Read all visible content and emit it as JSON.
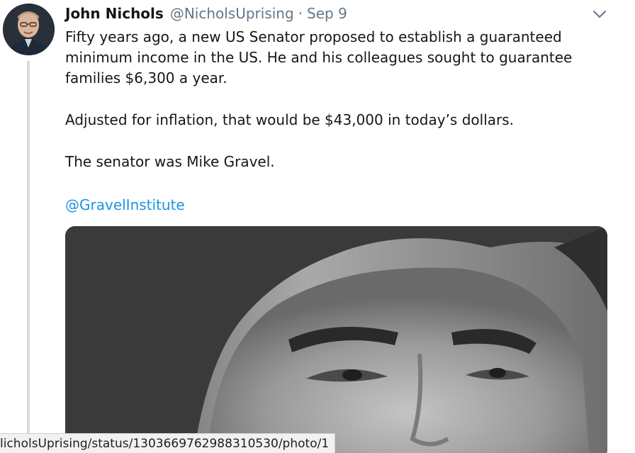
{
  "tweet": {
    "author_name": "John Nichols",
    "author_handle": "@NicholsUprising",
    "separator": "·",
    "date": "Sep 9",
    "lines": [
      "Fifty years ago, a new US Senator proposed to establish a guaranteed",
      "minimum income in the US. He and his colleagues sought to guarantee",
      "families $6,300 a year.",
      "Adjusted for inflation, that would be $43,000 in today’s dollars.",
      "The senator was Mike Gravel."
    ],
    "mention": "@GravelInstitute"
  },
  "icons": {
    "more": "chevron-down-icon"
  },
  "status_bar": {
    "url": "licholsUprising/status/1303669762988310530/photo/1"
  },
  "colors": {
    "link": "#1b95e0",
    "secondary_text": "#657786",
    "thread_line": "#d6dbe0"
  }
}
